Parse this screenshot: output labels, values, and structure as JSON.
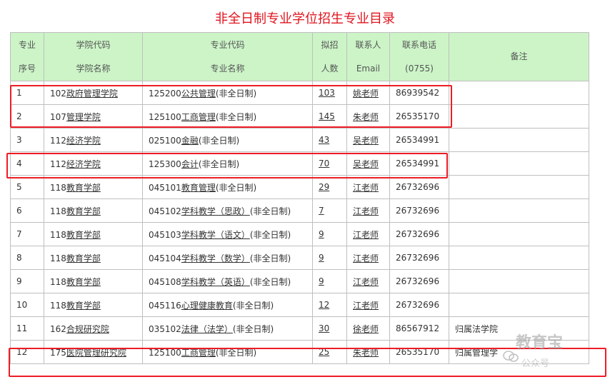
{
  "title": "非全日制专业学位招生专业目录",
  "headers": {
    "c1": [
      "专业",
      "序号"
    ],
    "c2": [
      "学院代码",
      "学院名称"
    ],
    "c3": [
      "专业代码",
      "专业名称"
    ],
    "c4": [
      "拟招",
      "人数"
    ],
    "c5": [
      "联系人",
      "Email"
    ],
    "c6": [
      "联系电话",
      "(0755)"
    ],
    "c7": [
      "备注"
    ]
  },
  "rows": [
    {
      "seq": "1",
      "college_code": "102",
      "college": "政府管理学院",
      "major_code": "125200",
      "major": "公共管理",
      "suffix": "(非全日制)",
      "count": "103",
      "contact": "姚老师",
      "phone": "86939542",
      "note": ""
    },
    {
      "seq": "2",
      "college_code": "107",
      "college": "管理学院",
      "major_code": "125100",
      "major": "工商管理",
      "suffix": "(非全日制)",
      "count": "145",
      "contact": "朱老师",
      "phone": "26535170",
      "note": ""
    },
    {
      "seq": "3",
      "college_code": "112",
      "college": "经济学院",
      "major_code": "025100",
      "major": "金融",
      "suffix": "(非全日制)",
      "count": "43",
      "contact": "吴老师",
      "phone": "26534991",
      "note": ""
    },
    {
      "seq": "4",
      "college_code": "112",
      "college": "经济学院",
      "major_code": "125300",
      "major": "会计",
      "suffix": "(非全日制)",
      "count": "70",
      "contact": "吴老师",
      "phone": "26534991",
      "note": ""
    },
    {
      "seq": "5",
      "college_code": "118",
      "college": "教育学部",
      "major_code": "045101",
      "major": "教育管理",
      "suffix": "(非全日制)",
      "count": "29",
      "contact": "江老师",
      "phone": "26732696",
      "note": ""
    },
    {
      "seq": "6",
      "college_code": "118",
      "college": "教育学部",
      "major_code": "045102",
      "major": "学科教学（思政）",
      "suffix": "(非全日制)",
      "count": "7",
      "contact": "江老师",
      "phone": "26732696",
      "note": ""
    },
    {
      "seq": "7",
      "college_code": "118",
      "college": "教育学部",
      "major_code": "045103",
      "major": "学科教学（语文）",
      "suffix": "(非全日制)",
      "count": "9",
      "contact": "江老师",
      "phone": "26732696",
      "note": ""
    },
    {
      "seq": "8",
      "college_code": "118",
      "college": "教育学部",
      "major_code": "045104",
      "major": "学科教学（数学）",
      "suffix": "(非全日制)",
      "count": "9",
      "contact": "江老师",
      "phone": "26732696",
      "note": ""
    },
    {
      "seq": "9",
      "college_code": "118",
      "college": "教育学部",
      "major_code": "045108",
      "major": "学科教学（英语）",
      "suffix": "(非全日制)",
      "count": "9",
      "contact": "江老师",
      "phone": "26732696",
      "note": ""
    },
    {
      "seq": "10",
      "college_code": "118",
      "college": "教育学部",
      "major_code": "045116",
      "major": "心理健康教育",
      "suffix": "(非全日制)",
      "count": "12",
      "contact": "江老师",
      "phone": "26732696",
      "note": ""
    },
    {
      "seq": "11",
      "college_code": "162",
      "college": "合规研究院",
      "major_code": "035102",
      "major": "法律（法学）",
      "suffix": "(非全日制)",
      "count": "30",
      "contact": "徐老师",
      "phone": "86567912",
      "note": "归属法学院"
    },
    {
      "seq": "12",
      "college_code": "175",
      "college": "医院管理研究院",
      "major_code": "125100",
      "major": "工商管理",
      "suffix": "(非全日制)",
      "count": "25",
      "contact": "朱老师",
      "phone": "26535170",
      "note": "归属管理学"
    }
  ],
  "watermark": {
    "line1": "教育宝",
    "line2": "公众号"
  },
  "colors": {
    "title": "#e0141e",
    "header_bg": "#ccf4c7",
    "highlight_box": "#ee1c25"
  }
}
